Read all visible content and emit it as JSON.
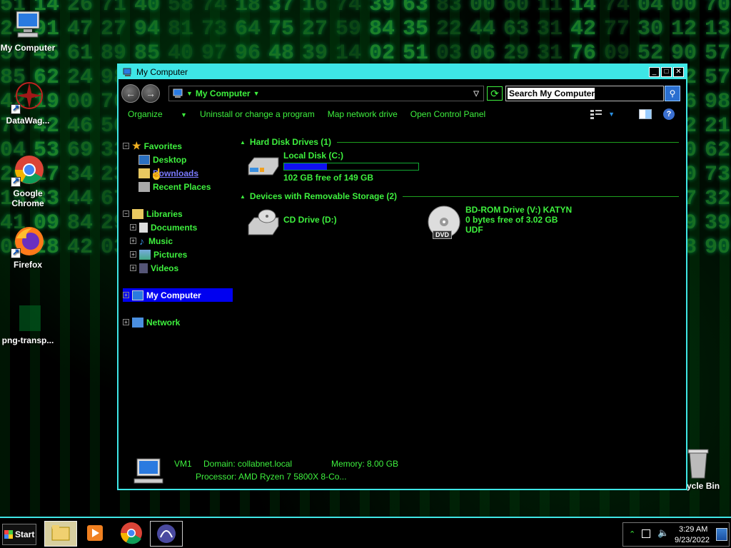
{
  "desktop": {
    "icons": [
      {
        "label": "My Computer"
      },
      {
        "label": "DataWag..."
      },
      {
        "label": "Google Chrome"
      },
      {
        "label": "Firefox"
      },
      {
        "label": "png-transp..."
      },
      {
        "label": "ycle Bin"
      }
    ]
  },
  "window": {
    "title": "My Computer",
    "address": {
      "crumb": "My Computer"
    },
    "search": {
      "value": "Search My Computer"
    },
    "commands": {
      "organize": "Organize",
      "uninstall": "Uninstall or change a program",
      "map_drive": "Map network drive",
      "control_panel": "Open Control Panel"
    },
    "nav": {
      "favorites": "Favorites",
      "desktop": "Desktop",
      "downloads": "Downloads",
      "recent": "Recent Places",
      "libraries": "Libraries",
      "documents": "Documents",
      "music": "Music",
      "pictures": "Pictures",
      "videos": "Videos",
      "my_computer": "My Computer",
      "network": "Network"
    },
    "groups": {
      "hdd": "Hard Disk Drives (1)",
      "removable": "Devices with Removable Storage (2)"
    },
    "drives": {
      "c": {
        "name": "Local Disk (C:)",
        "free": "102 GB free of 149 GB",
        "used_fraction": 0.32
      },
      "d": {
        "name": "CD Drive (D:)"
      },
      "v": {
        "name": "BD-ROM Drive (V:) KATYN",
        "free": "0 bytes free of 3.02 GB",
        "fs": "UDF",
        "badge": "DVD"
      }
    },
    "details": {
      "name": "VM1",
      "domain": "Domain: collabnet.local",
      "memory": "Memory: 8.00 GB",
      "processor": "Processor: AMD Ryzen 7 5800X 8-Co..."
    }
  },
  "taskbar": {
    "start": "Start",
    "time": "3:29 AM",
    "date": "9/23/2022"
  },
  "colors": {
    "accent": "#3ee6e6",
    "text": "#3ef03e",
    "selection": "#0000f0"
  }
}
